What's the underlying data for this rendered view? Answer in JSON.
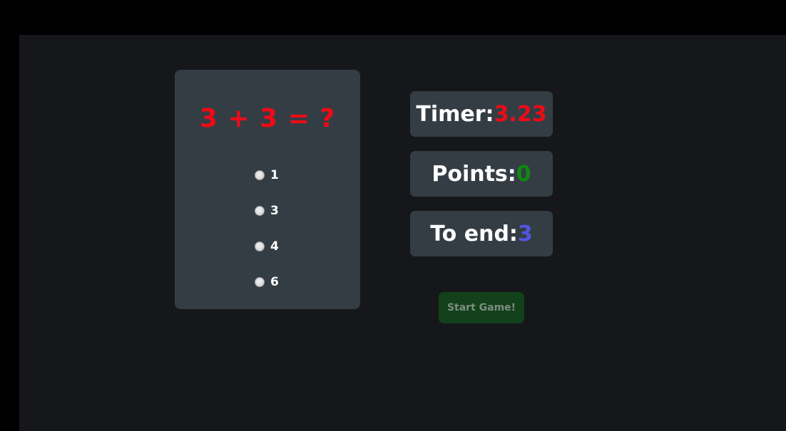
{
  "question": {
    "text": "3 + 3 = ?",
    "color": "#ee0b16"
  },
  "options": [
    {
      "label": "1"
    },
    {
      "label": "3"
    },
    {
      "label": "4"
    },
    {
      "label": "6"
    }
  ],
  "stats": {
    "timer": {
      "label": "Timer:",
      "value": "3.23",
      "value_color": "#ee0b16"
    },
    "points": {
      "label": "Points:",
      "value": "0",
      "value_color": "#0d8a12"
    },
    "to_end": {
      "label": "To end:",
      "value": "3",
      "value_color": "#5454e0"
    }
  },
  "start_button": {
    "label": "Start Game!"
  }
}
